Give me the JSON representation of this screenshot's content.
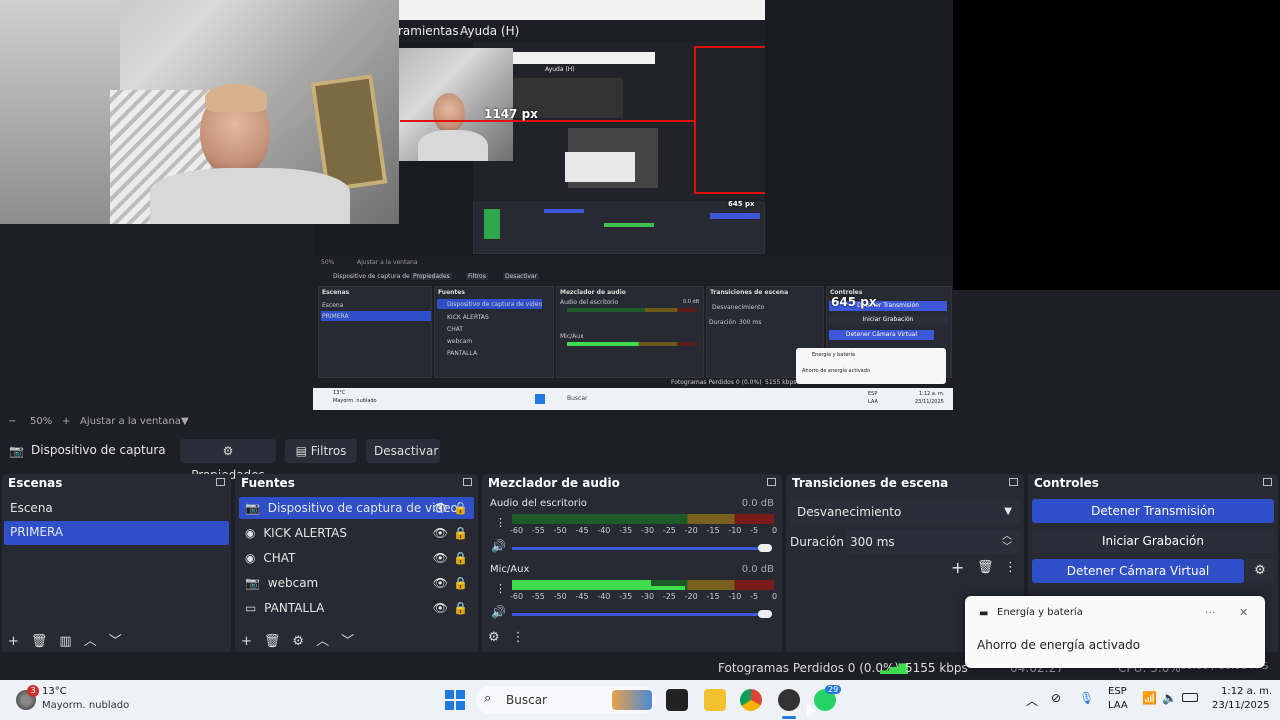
{
  "preview": {
    "menu_partial": "ramientas",
    "menu_help": "Ayuda (H)",
    "nested_help": "Ayuda (H)",
    "measure_width": "1147 px",
    "measure_height": "645 px",
    "measure_height_2": "645 px",
    "nested_zoom": "50%",
    "nested_fit": "Ajustar a la ventana",
    "nested_source": "Dispositivo de captura de v",
    "nested_props": "Propiedades",
    "nested_filters": "Filtros",
    "nested_deactivate": "Desactivar",
    "nested_scenes": "Escenas",
    "nested_sources": "Fuentes",
    "nested_mixer": "Mezclador de audio",
    "nested_transitions": "Transiciones de escena",
    "nested_controls": "Controles",
    "nested_scene_items": [
      "Escena",
      "PRIMERA"
    ],
    "nested_source_items": [
      "Dispositivo de captura de video",
      "KICK ALERTAS",
      "CHAT",
      "webcam",
      "PANTALLA"
    ],
    "nested_desktop_audio": "Audio del escritorio",
    "nested_mic": "Mic/Aux",
    "nested_fade": "Desvanecimiento",
    "nested_duration_label": "Duración",
    "nested_duration": "300 ms",
    "nested_stop_stream": "Detener Transmisión",
    "nested_start_rec": "Iniciar Grabación",
    "nested_stop_vcam": "Detener Cámara Virtual",
    "nested_notif_title": "Energía y batería",
    "nested_notif_body": "Ahorro de energía activado",
    "nested_dropped": "Fotogramas Perdidos 0 (0.0%)",
    "nested_kbps": "5155 kbps",
    "nested_search": "Buscar",
    "nested_temp": "13°C",
    "nested_weather": "Mayorm. nublado",
    "nested_lang1": "ESP",
    "nested_lang2": "LAA",
    "nested_time": "1:12 a. m.",
    "nested_date": "23/11/2025",
    "nested_db": "0.0 dB"
  },
  "zoom": {
    "level": "50%",
    "fit": "Ajustar a la ventana"
  },
  "source_toolbar": {
    "source_name": "Dispositivo de captura de v",
    "properties": "Propiedades",
    "filters": "Filtros",
    "deactivate": "Desactivar"
  },
  "scenes": {
    "title": "Escenas",
    "items": [
      "Escena",
      "PRIMERA"
    ],
    "selected": 1
  },
  "sources": {
    "title": "Fuentes",
    "items": [
      "Dispositivo de captura de video",
      "KICK ALERTAS",
      "CHAT",
      "webcam",
      "PANTALLA"
    ],
    "selected": 0
  },
  "mixer": {
    "title": "Mezclador de audio",
    "desktop_label": "Audio del escritorio",
    "desktop_db": "0.0 dB",
    "mic_label": "Mic/Aux",
    "mic_db": "0.0 dB",
    "scale": [
      "-60",
      "-55",
      "-50",
      "-45",
      "-40",
      "-35",
      "-30",
      "-25",
      "-20",
      "-15",
      "-10",
      "-5",
      "0"
    ]
  },
  "transitions": {
    "title": "Transiciones de escena",
    "selected": "Desvanecimiento",
    "duration_label": "Duración",
    "duration": "300 ms"
  },
  "controls": {
    "title": "Controles",
    "stop_stream": "Detener Transmisión",
    "start_recording": "Iniciar Grabación",
    "stop_virtual_cam": "Detener Cámara Virtual"
  },
  "status": {
    "dropped": "Fotogramas Perdidos 0 (0.0%)",
    "kbps": "5155 kbps",
    "partial_time": "04:02:27",
    "partial_cpu": "CPU: 3.0%",
    "partial_fps": "60.00 / 60.00 FPS"
  },
  "notification": {
    "title": "Energía y batería",
    "body": "Ahorro de energía activado",
    "more": "···",
    "close": "✕"
  },
  "taskbar": {
    "weather_badge": "3",
    "temperature": "13°C",
    "weather": "Mayorm. nublado",
    "search": "Buscar",
    "whatsapp_badge": "29",
    "lang1": "ESP",
    "lang2": "LAA",
    "time": "1:12 a. m.",
    "date": "23/11/2025"
  },
  "colors": {
    "accent": "#2f4fc9",
    "panel": "#272a33",
    "bg": "#1e1f26",
    "measure": "#e01010"
  }
}
